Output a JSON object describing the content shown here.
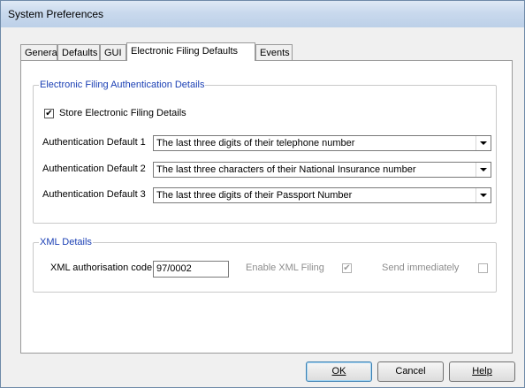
{
  "window": {
    "title": "System Preferences"
  },
  "tabs": [
    {
      "label": "General"
    },
    {
      "label": "Defaults"
    },
    {
      "label": "GUI"
    },
    {
      "label": "Electronic Filing Defaults"
    },
    {
      "label": "Events"
    }
  ],
  "active_tab": "Electronic Filing Defaults",
  "auth_group": {
    "title": "Electronic Filing Authentication Details",
    "store_checkbox": {
      "label": "Store Electronic Filing Details",
      "checked": true,
      "glyph": "✔"
    },
    "defaults": [
      {
        "label": "Authentication Default 1",
        "value": "The last three digits of their telephone number"
      },
      {
        "label": "Authentication Default 2",
        "value": "The last three characters of their National Insurance number"
      },
      {
        "label": "Authentication Default 3",
        "value": "The last three digits of their Passport Number"
      }
    ]
  },
  "xml_group": {
    "title": "XML Details",
    "auth_code_label": "XML authorisation code:",
    "auth_code_value": "97/0002",
    "enable_label": "Enable XML Filing",
    "enable_checked": true,
    "enable_glyph": "✔",
    "send_label": "Send immediately",
    "send_checked": false
  },
  "buttons": {
    "ok": "OK",
    "cancel": "Cancel",
    "help": "Help"
  }
}
